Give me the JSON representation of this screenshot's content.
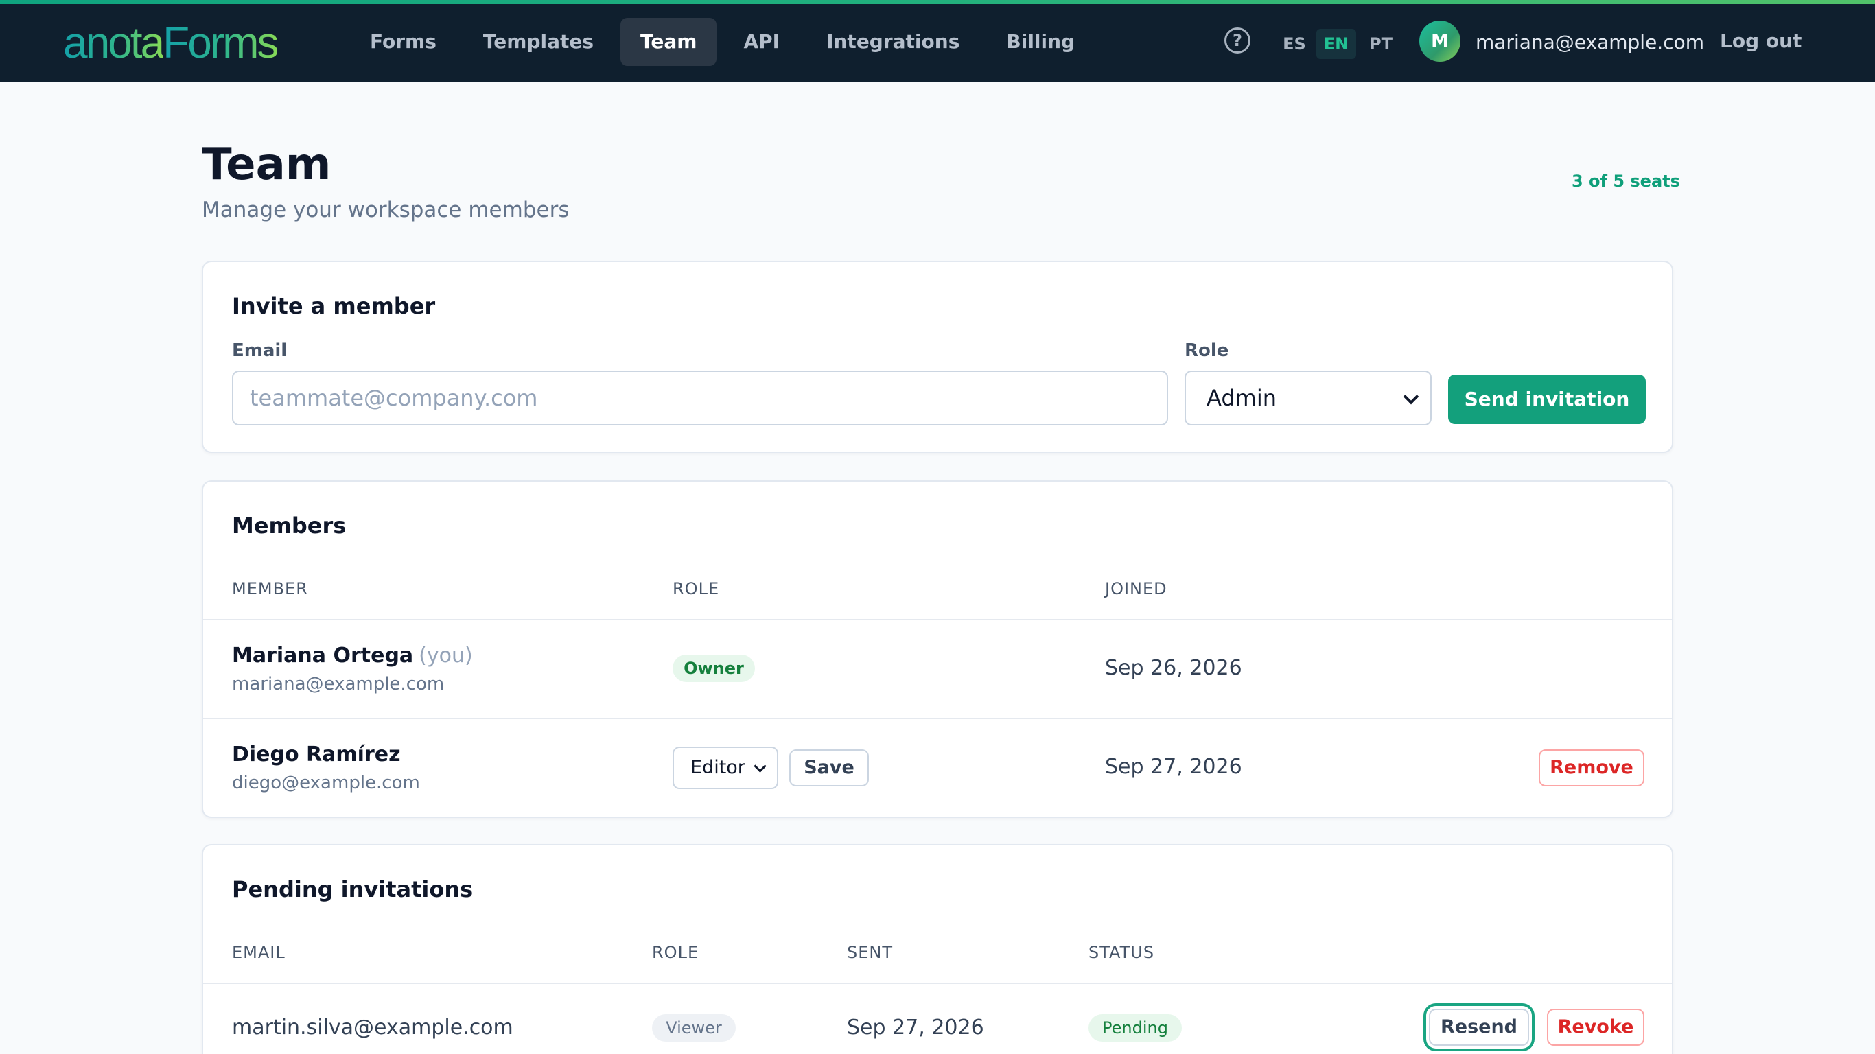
{
  "app": {
    "logo_part1": "anota",
    "logo_part2": "Forms"
  },
  "nav": {
    "items": [
      {
        "label": "Forms"
      },
      {
        "label": "Templates"
      },
      {
        "label": "Team"
      },
      {
        "label": "API"
      },
      {
        "label": "Integrations"
      },
      {
        "label": "Billing"
      }
    ],
    "active": "Team"
  },
  "header_right": {
    "help_icon": "question-circle-icon",
    "languages": [
      "ES",
      "EN",
      "PT"
    ],
    "active_language": "EN",
    "avatar_initial": "M",
    "user_email": "mariana@example.com",
    "logout_label": "Log out"
  },
  "page": {
    "title": "Team",
    "subtitle": "Manage your workspace members",
    "seats": "3 of 5 seats"
  },
  "invite": {
    "title": "Invite a member",
    "email_label": "Email",
    "email_placeholder": "teammate@company.com",
    "email_value": "",
    "role_label": "Role",
    "role_value": "Admin",
    "send_label": "Send invitation"
  },
  "members": {
    "title": "Members",
    "columns": [
      "MEMBER",
      "ROLE",
      "JOINED"
    ],
    "rows": [
      {
        "name": "Mariana Ortega",
        "you": "(you)",
        "email": "mariana@example.com",
        "role": "Owner",
        "joined": "Sep 26, 2026"
      },
      {
        "name": "Diego Ramírez",
        "email": "diego@example.com",
        "role": "Editor",
        "save_label": "Save",
        "joined": "Sep 27, 2026",
        "remove_label": "Remove"
      }
    ]
  },
  "pending": {
    "title": "Pending invitations",
    "columns": [
      "EMAIL",
      "ROLE",
      "SENT",
      "STATUS"
    ],
    "rows": [
      {
        "email": "martin.silva@example.com",
        "role": "Viewer",
        "sent": "Sep 27, 2026",
        "status": "Pending",
        "resend_label": "Resend",
        "revoke_label": "Revoke"
      }
    ]
  },
  "colors": {
    "brand": "#13a07c",
    "topbar": "#0f1f2e",
    "danger": "#dc2626"
  }
}
